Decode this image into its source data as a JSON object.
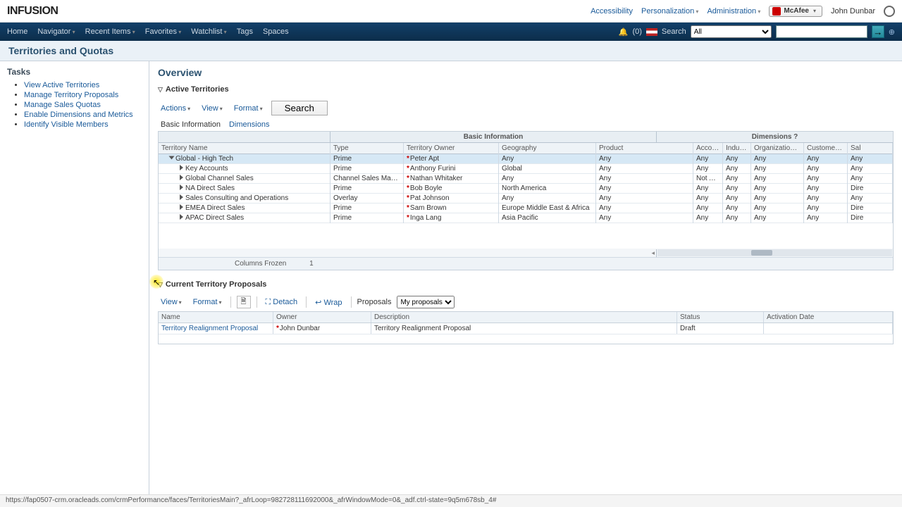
{
  "brand": "INFUSION",
  "top_links": {
    "accessibility": "Accessibility",
    "personalization": "Personalization",
    "administration": "Administration"
  },
  "mcafee": "McAfee",
  "user": "John Dunbar",
  "nav": {
    "home": "Home",
    "navigator": "Navigator",
    "recent": "Recent Items",
    "favorites": "Favorites",
    "watchlist": "Watchlist",
    "tags": "Tags",
    "spaces": "Spaces",
    "notif_count": "(0)",
    "search_label": "Search",
    "search_scope": "All"
  },
  "page_title": "Territories and Quotas",
  "tasks_header": "Tasks",
  "tasks": [
    "View Active Territories",
    "Manage Territory Proposals",
    "Manage Sales Quotas",
    "Enable Dimensions and Metrics",
    "Identify Visible Members"
  ],
  "overview_header": "Overview",
  "sections": {
    "active": "Active Territories",
    "proposals": "Current Territory Proposals"
  },
  "menus": {
    "actions": "Actions",
    "view": "View",
    "format": "Format",
    "search": "Search"
  },
  "subtabs": {
    "basic": "Basic Information",
    "dim": "Dimensions"
  },
  "col_groups": {
    "basic": "Basic Information",
    "dim": "Dimensions ?"
  },
  "cols": {
    "name": "Territory Name",
    "type": "Type",
    "owner": "Territory Owner",
    "geo": "Geography",
    "prod": "Product",
    "acct": "Account",
    "ind": "Industry",
    "org": "Organization Type",
    "cust": "Customer Size",
    "sales": "Sal"
  },
  "rows": [
    {
      "name": "Global - High Tech",
      "indent": 1,
      "open": true,
      "type": "Prime",
      "owner": "Peter Apt",
      "geo": "Any",
      "prod": "Any",
      "acct": "Any",
      "ind": "Any",
      "org": "Any",
      "cust": "Any",
      "sales": "Any",
      "selected": true
    },
    {
      "name": "Key Accounts",
      "indent": 2,
      "type": "Prime",
      "owner": "Anthony Furini",
      "geo": "Global",
      "prod": "Any",
      "acct": "Any",
      "ind": "Any",
      "org": "Any",
      "cust": "Any",
      "sales": "Any"
    },
    {
      "name": "Global Channel Sales",
      "indent": 2,
      "type": "Channel Sales Manager",
      "owner": "Nathan Whitaker",
      "geo": "Any",
      "prod": "Any",
      "acct": "Not Applic",
      "ind": "Any",
      "org": "Any",
      "cust": "Any",
      "sales": "Any"
    },
    {
      "name": "NA Direct Sales",
      "indent": 2,
      "type": "Prime",
      "owner": "Bob Boyle",
      "geo": "North America",
      "prod": "Any",
      "acct": "Any",
      "ind": "Any",
      "org": "Any",
      "cust": "Any",
      "sales": "Dire"
    },
    {
      "name": "Sales Consulting and Operations",
      "indent": 2,
      "type": "Overlay",
      "owner": "Pat Johnson",
      "geo": "Any",
      "prod": "Any",
      "acct": "Any",
      "ind": "Any",
      "org": "Any",
      "cust": "Any",
      "sales": "Any"
    },
    {
      "name": "EMEA Direct Sales",
      "indent": 2,
      "type": "Prime",
      "owner": "Sam Brown",
      "geo": "Europe Middle East & Africa",
      "prod": "Any",
      "acct": "Any",
      "ind": "Any",
      "org": "Any",
      "cust": "Any",
      "sales": "Dire"
    },
    {
      "name": "APAC Direct Sales",
      "indent": 2,
      "type": "Prime",
      "owner": "Inga Lang",
      "geo": "Asia Pacific",
      "prod": "Any",
      "acct": "Any",
      "ind": "Any",
      "org": "Any",
      "cust": "Any",
      "sales": "Dire"
    }
  ],
  "frozen": {
    "label": "Columns Frozen",
    "value": "1"
  },
  "prop_menus": {
    "view": "View",
    "format": "Format",
    "detach": "Detach",
    "wrap": "Wrap",
    "proposals": "Proposals",
    "my_proposals": "My proposals"
  },
  "pcols": {
    "name": "Name",
    "owner": "Owner",
    "desc": "Description",
    "status": "Status",
    "act": "Activation Date"
  },
  "prows": [
    {
      "name": "Territory Realignment Proposal",
      "owner": "John Dunbar",
      "desc": "Territory Realignment Proposal",
      "status": "Draft",
      "act": ""
    }
  ],
  "status_url": "https://fap0507-crm.oracleads.com/crmPerformance/faces/TerritoriesMain?_afrLoop=982728111692000&_afrWindowMode=0&_adf.ctrl-state=9q5m678sb_4#"
}
